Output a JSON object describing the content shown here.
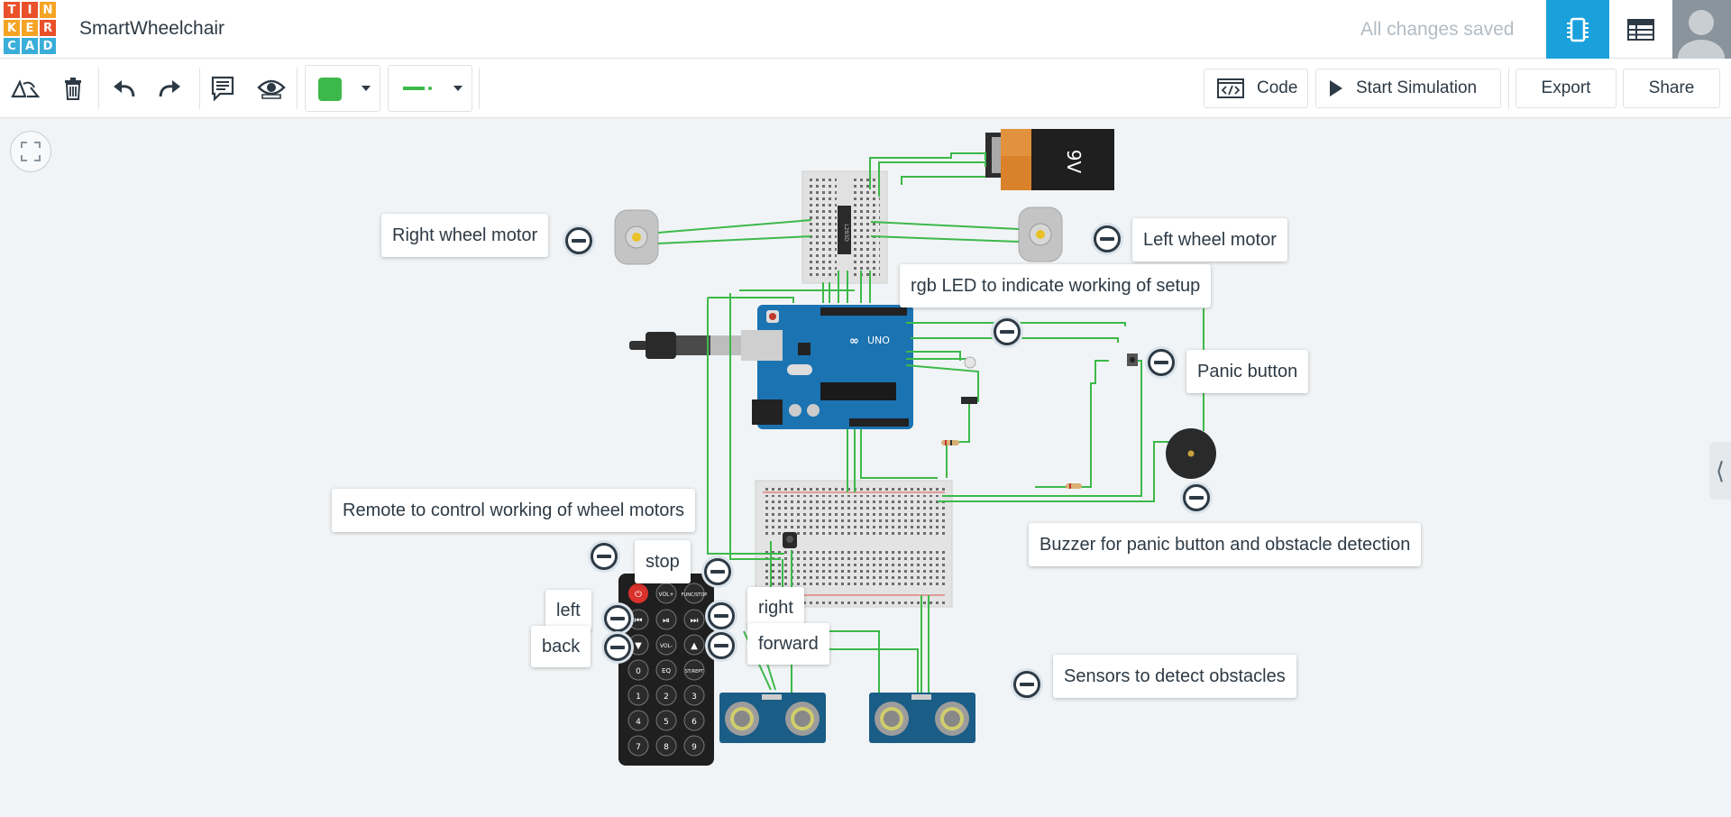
{
  "header": {
    "logo_letters": [
      "T",
      "I",
      "N",
      "K",
      "E",
      "R",
      "C",
      "A",
      "D"
    ],
    "logo_colors": [
      "#e9512a",
      "#e9512a",
      "#f5a425",
      "#f5a425",
      "#f5a425",
      "#e9512a",
      "#3aaed8",
      "#3aaed8",
      "#3aaed8"
    ],
    "title": "SmartWheelchair",
    "save_status": "All changes saved",
    "accent": "#1aa1dc"
  },
  "toolbar": {
    "fill_color": "#3cb94a",
    "wire_color": "#3cb94a",
    "code_label": "Code",
    "simulate_label": "Start Simulation",
    "export_label": "Export",
    "share_label": "Share"
  },
  "battery": {
    "label": "9V"
  },
  "notes": {
    "right_motor": "Right wheel motor",
    "left_motor": "Left wheel motor",
    "rgb_led": "rgb LED to indicate working of setup",
    "panic": "Panic button",
    "remote": "Remote to control working of wheel motors",
    "buzzer": "Buzzer for panic button and obstacle detection",
    "sensors": "Sensors to detect obstacles",
    "stop": "stop",
    "left": "left",
    "right": "right",
    "back": "back",
    "forward": "forward"
  },
  "remote_keys": [
    "⏻",
    "VOL+",
    "FUNC/STOP",
    "⏮",
    "⏯",
    "⏭",
    "▼",
    "VOL-",
    "▲",
    "0",
    "EQ",
    "ST/REPT",
    "1",
    "2",
    "3",
    "4",
    "5",
    "6",
    "7",
    "8",
    "9"
  ]
}
